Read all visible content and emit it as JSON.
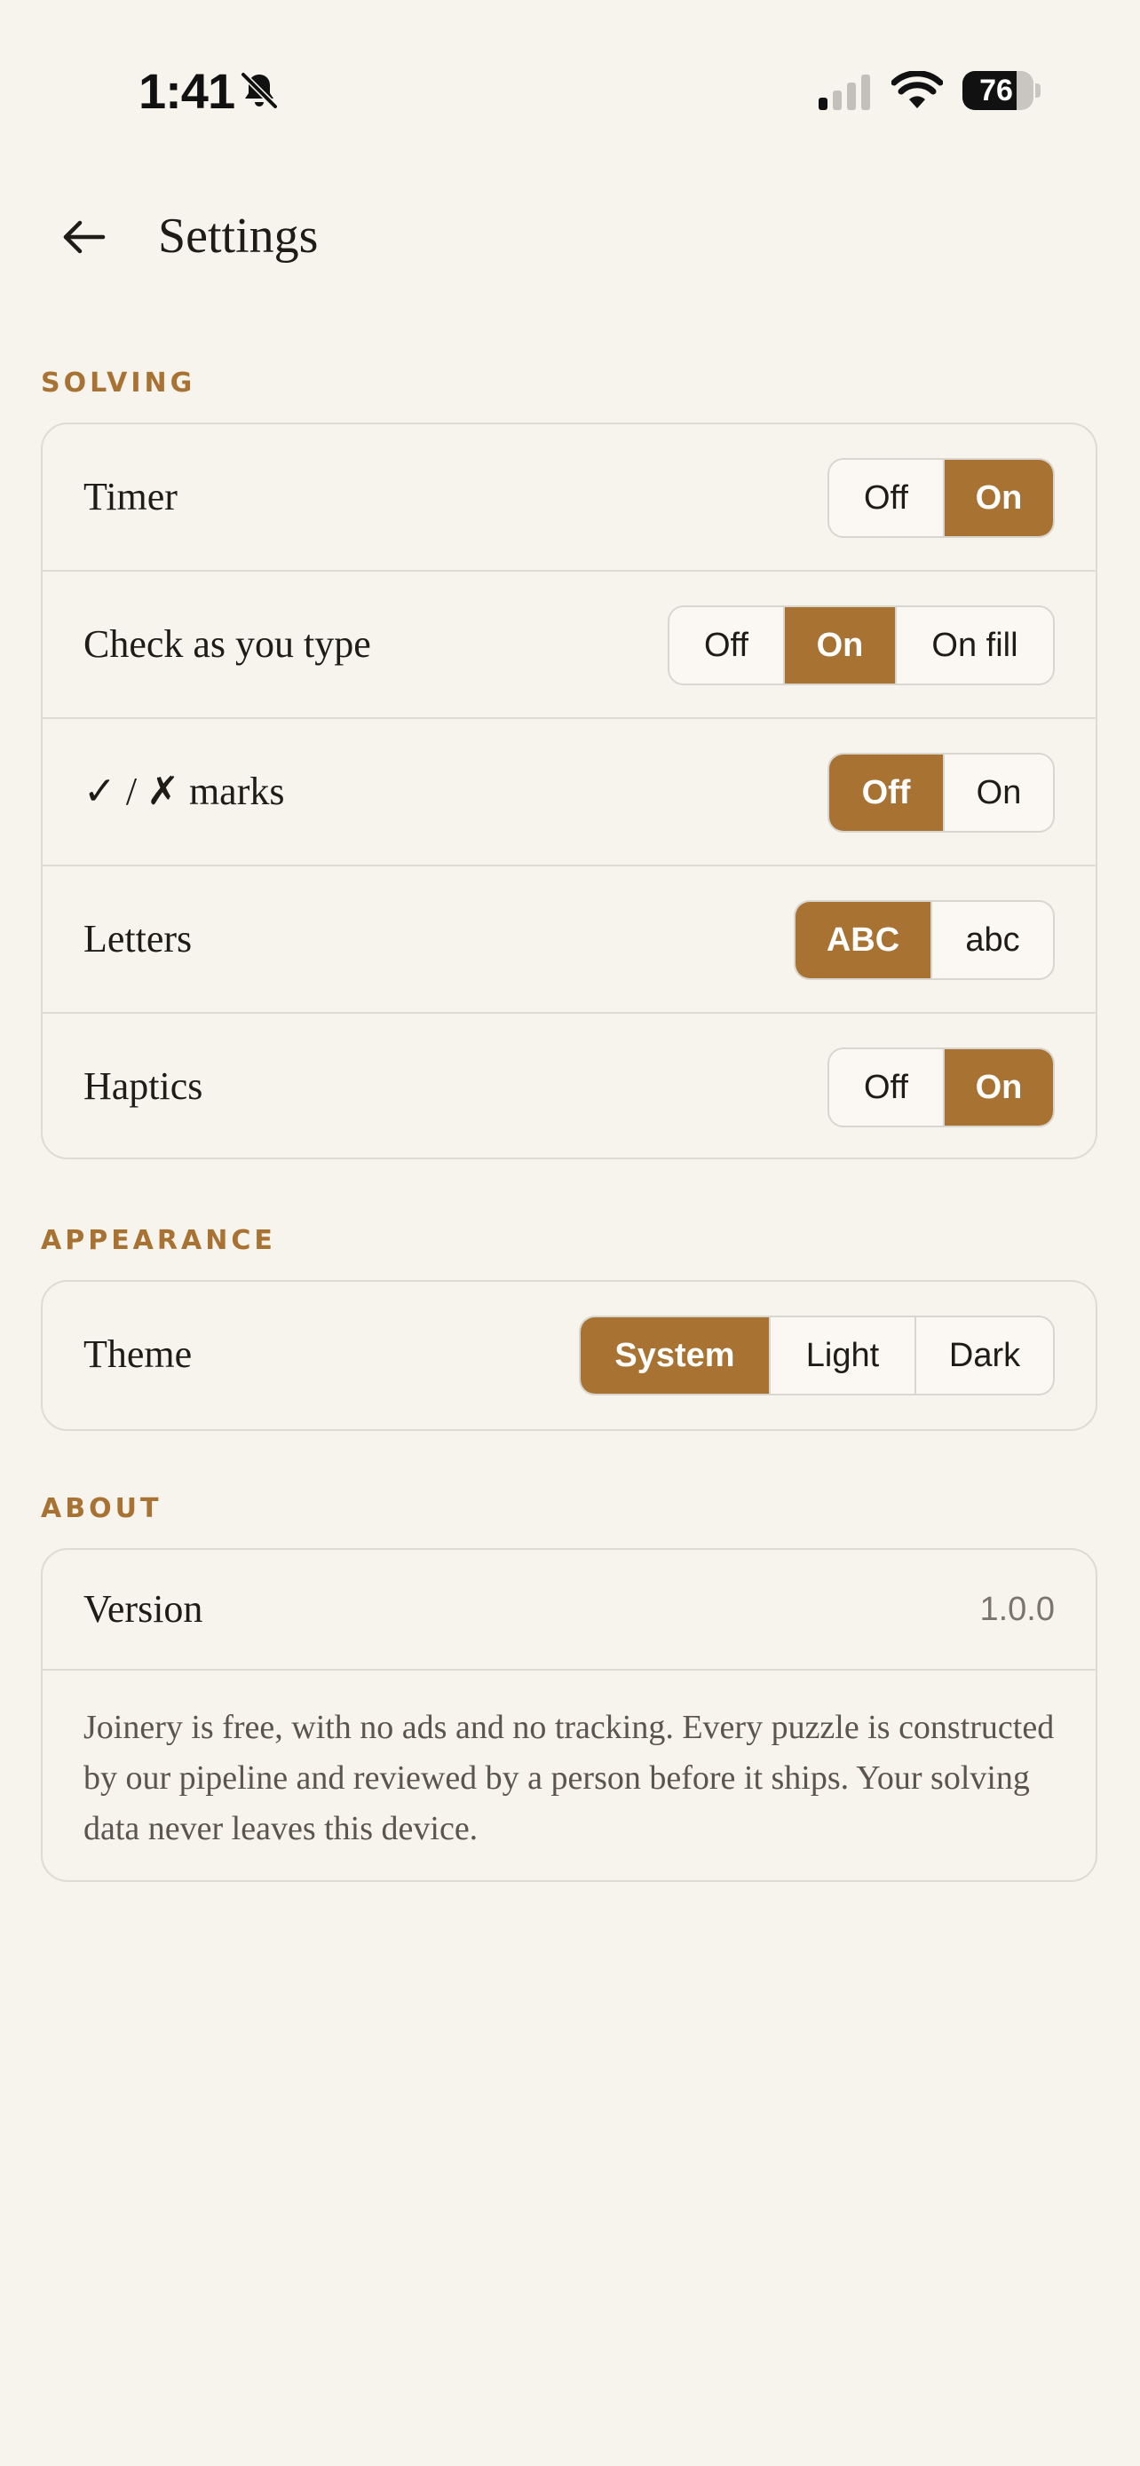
{
  "status_bar": {
    "time": "1:41",
    "battery": "76",
    "battery_level": 0.76,
    "icons": [
      "bell-slash-icon",
      "cellular-signal-icon",
      "wifi-icon",
      "battery-icon"
    ]
  },
  "header": {
    "title": "Settings",
    "back_icon": "arrow-left-icon"
  },
  "colors": {
    "accent": "#A87232",
    "background": "#F7F3ED",
    "border": "#DEDAD4"
  },
  "sections": {
    "solving": {
      "label": "SOLVING",
      "rows": {
        "timer": {
          "label": "Timer",
          "options": [
            "Off",
            "On"
          ],
          "selected": "On"
        },
        "check": {
          "label": "Check as you type",
          "options": [
            "Off",
            "On",
            "On fill"
          ],
          "selected": "On"
        },
        "marks": {
          "label": "✓ / ✗ marks",
          "options": [
            "Off",
            "On"
          ],
          "selected": "Off"
        },
        "letters": {
          "label": "Letters",
          "options": [
            "ABC",
            "abc"
          ],
          "selected": "ABC"
        },
        "haptics": {
          "label": "Haptics",
          "options": [
            "Off",
            "On"
          ],
          "selected": "On"
        }
      }
    },
    "appearance": {
      "label": "APPEARANCE",
      "rows": {
        "theme": {
          "label": "Theme",
          "options": [
            "System",
            "Light",
            "Dark"
          ],
          "selected": "System"
        }
      }
    },
    "about": {
      "label": "ABOUT",
      "version_label": "Version",
      "version_value": "1.0.0",
      "text": "Joinery is free, with no ads and no tracking. Every puzzle is constructed by our pipeline and reviewed by a person before it ships. Your solving data never leaves this device."
    }
  }
}
